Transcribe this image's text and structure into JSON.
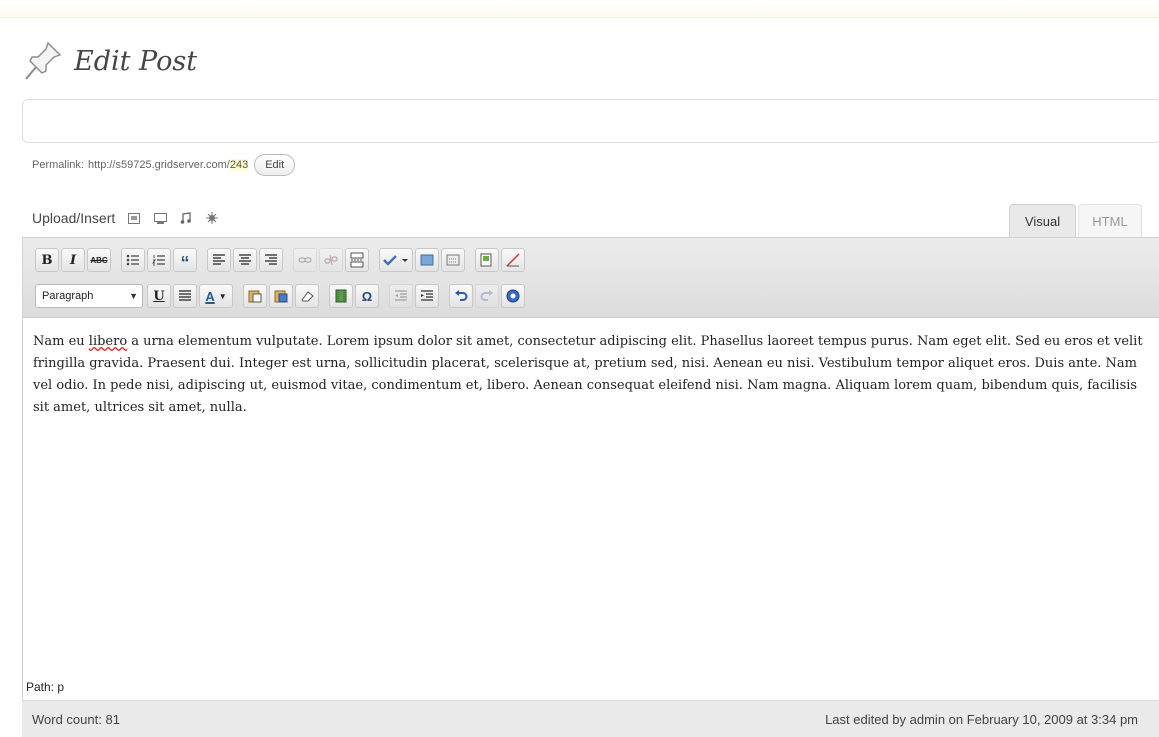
{
  "page": {
    "title": "Edit Post"
  },
  "post_title": {
    "value": "",
    "placeholder": ""
  },
  "permalink": {
    "label": "Permalink:",
    "base": "http://s59725.gridserver.com/",
    "slug": "243",
    "edit_label": "Edit"
  },
  "media": {
    "label": "Upload/Insert",
    "icons": [
      "add-image-icon",
      "add-video-icon",
      "add-audio-icon",
      "add-media-icon"
    ]
  },
  "tabs": {
    "visual": "Visual",
    "html": "HTML",
    "active": "visual"
  },
  "toolbar": {
    "row1_icons": [
      "bold-icon",
      "italic-icon",
      "strikethrough-icon",
      "bullet-list-icon",
      "numbered-list-icon",
      "blockquote-icon",
      "align-left-icon",
      "align-center-icon",
      "align-right-icon",
      "insert-link-icon",
      "unlink-icon",
      "insert-more-icon",
      "spellcheck-icon",
      "fullscreen-icon",
      "kitchen-sink-icon",
      "insert-gallery-icon",
      "clear-icon"
    ],
    "format_select": "Paragraph",
    "bold": "B",
    "italic": "I",
    "strike": "ABC",
    "blockquote": "“",
    "underline": "U",
    "text_color": "A",
    "omega": "Ω"
  },
  "content": {
    "pre": "Nam eu ",
    "misspelled": "libero",
    "post": " a urna elementum vulputate. Lorem ipsum dolor sit amet, consectetur adipiscing elit. Phasellus laoreet tempus purus. Nam eget elit. Sed eu eros et velit fringilla gravida. Praesent dui. Integer est urna, sollicitudin placerat, scelerisque at, pretium sed, nisi. Aenean eu nisi. Vestibulum tempor aliquet eros. Duis ante. Nam vel odio. In pede nisi, adipiscing ut, euismod vitae, condimentum et, libero. Aenean consequat eleifend nisi. Nam magna. Aliquam lorem quam, bibendum quis, facilisis sit amet, ultrices sit amet, nulla."
  },
  "path": "Path: p",
  "status": {
    "word_count": "Word count: 81",
    "last_edited": "Last edited by admin on February 10, 2009 at 3:34 pm"
  },
  "colors": {
    "accent": "#21759b",
    "title_text": "#464646",
    "toolbar_bg": "#e4e4e4",
    "slug_highlight": "#fffbcc"
  }
}
